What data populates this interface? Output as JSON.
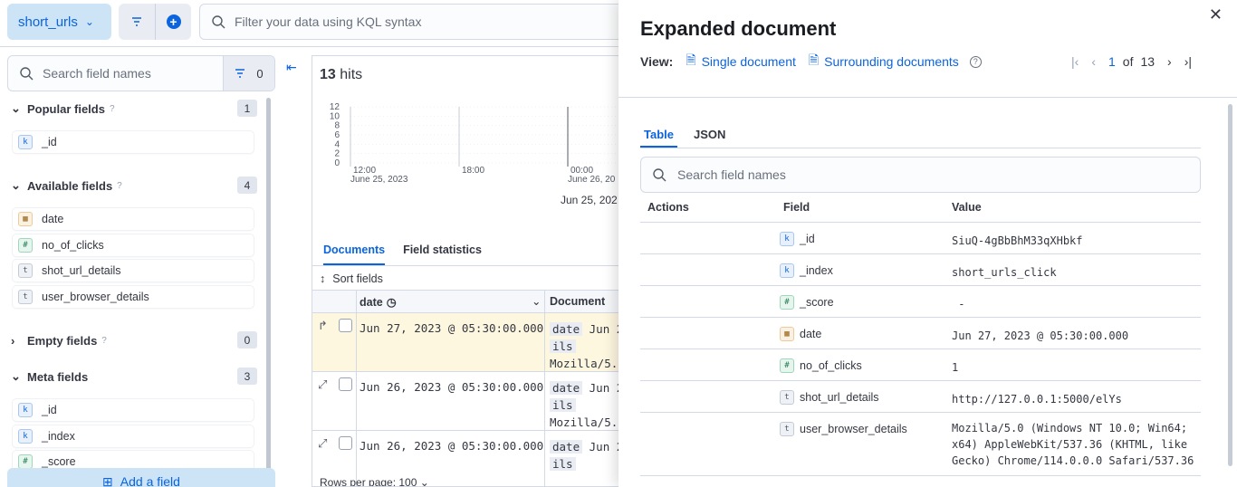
{
  "topbar": {
    "data_view": "short_urls",
    "kql_placeholder": "Filter your data using KQL syntax"
  },
  "sidebar": {
    "search_placeholder": "Search field names",
    "filter_count": "0",
    "popular": {
      "label": "Popular fields",
      "count": "1",
      "fields": [
        {
          "type": "k",
          "name": "_id"
        }
      ]
    },
    "available": {
      "label": "Available fields",
      "count": "4",
      "fields": [
        {
          "type": "d",
          "name": "date"
        },
        {
          "type": "#",
          "name": "no_of_clicks"
        },
        {
          "type": "t",
          "name": "shot_url_details"
        },
        {
          "type": "t",
          "name": "user_browser_details"
        }
      ]
    },
    "empty": {
      "label": "Empty fields",
      "count": "0"
    },
    "meta": {
      "label": "Meta fields",
      "count": "3",
      "fields": [
        {
          "type": "k",
          "name": "_id"
        },
        {
          "type": "k",
          "name": "_index"
        },
        {
          "type": "#",
          "name": "_score"
        }
      ]
    },
    "add_field": "Add a field"
  },
  "main": {
    "hits_count": "13",
    "hits_label": "hits",
    "tabs": [
      "Documents",
      "Field statistics"
    ],
    "sort_label": "Sort fields",
    "col_date": "date",
    "col_document": "Document",
    "rows": [
      {
        "date": "Jun 27, 2023 @ 05:30:00.000",
        "key": "date",
        "frag1": "Jun 2",
        "line2": "ils",
        "line3": "Mozilla/5.0"
      },
      {
        "date": "Jun 26, 2023 @ 05:30:00.000",
        "key": "date",
        "frag1": "Jun 2",
        "line2": "ils",
        "line3": "Mozilla/5.0"
      },
      {
        "date": "Jun 26, 2023 @ 05:30:00.000",
        "key": "date",
        "frag1": "Jun 2",
        "line2": "ils",
        "line3": ""
      }
    ],
    "rows_per_page": "Rows per page: 100"
  },
  "chart_data": {
    "type": "bar",
    "y_ticks": [
      "12",
      "10",
      "8",
      "6",
      "4",
      "2",
      "0"
    ],
    "x_ticks": [
      "12:00",
      "18:00",
      "00:00"
    ],
    "x_sublabels": [
      "June 25, 2023",
      "",
      "June 26, 20"
    ],
    "x_title": "Jun 25, 202",
    "ylim": [
      0,
      12
    ]
  },
  "flyout": {
    "title": "Expanded document",
    "view_label": "View:",
    "single_document": "Single document",
    "surrounding_documents": "Surrounding documents",
    "page_current": "1",
    "page_of": "of",
    "page_total": "13",
    "tabs": [
      "Table",
      "JSON"
    ],
    "search_placeholder": "Search field names",
    "col_actions": "Actions",
    "col_field": "Field",
    "col_value": "Value",
    "fields": [
      {
        "type": "k",
        "name": "_id",
        "value": "SiuQ-4gBbBhM33qXHbkf"
      },
      {
        "type": "k",
        "name": "_index",
        "value": "short_urls_click"
      },
      {
        "type": "#",
        "name": "_score",
        "value": " -"
      },
      {
        "type": "d",
        "name": "date",
        "value": "Jun 27, 2023 @ 05:30:00.000"
      },
      {
        "type": "#",
        "name": "no_of_clicks",
        "value": "1"
      },
      {
        "type": "t",
        "name": "shot_url_details",
        "value": "http://127.0.0.1:5000/elYs"
      },
      {
        "type": "t",
        "name": "user_browser_details",
        "value": "Mozilla/5.0 (Windows NT 10.0; Win64; x64) AppleWebKit/537.36 (KHTML, like Gecko) Chrome/114.0.0.0 Safari/537.36"
      }
    ]
  }
}
